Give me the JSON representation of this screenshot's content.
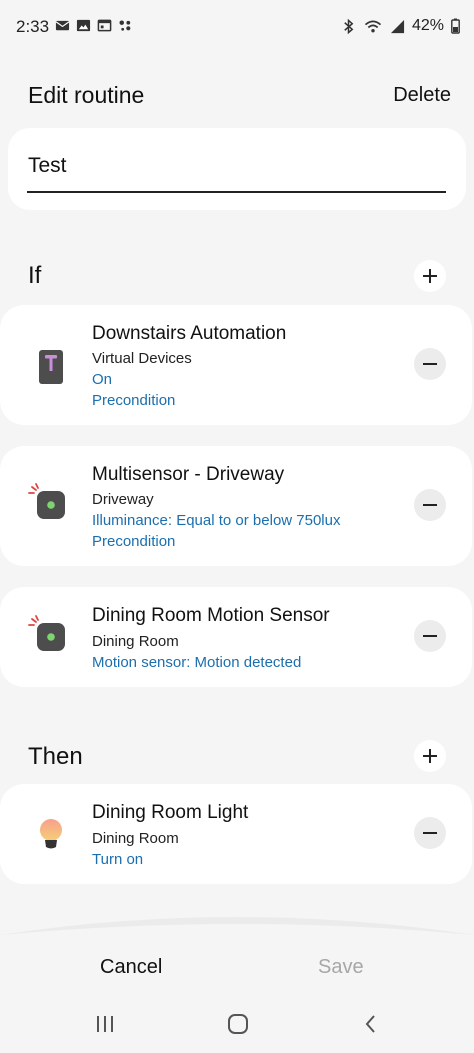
{
  "status_bar": {
    "time": "2:33",
    "battery": "42%"
  },
  "header": {
    "title": "Edit routine",
    "delete_label": "Delete"
  },
  "routine_name": {
    "value": "Test"
  },
  "if_section": {
    "title": "If",
    "conditions": [
      {
        "title": "Downstairs Automation",
        "subtitle": "Virtual Devices",
        "lines": [
          "On",
          "Precondition"
        ],
        "icon": "virtual-switch-icon"
      },
      {
        "title": "Multisensor - Driveway",
        "subtitle": "Driveway",
        "lines": [
          "Illuminance: Equal to or below 750lux",
          "Precondition"
        ],
        "icon": "sensor-icon"
      },
      {
        "title": "Dining Room Motion Sensor",
        "subtitle": "Dining Room",
        "lines": [
          "Motion sensor: Motion detected"
        ],
        "icon": "sensor-icon"
      }
    ]
  },
  "then_section": {
    "title": "Then",
    "actions": [
      {
        "title": "Dining Room Light",
        "subtitle": "Dining Room",
        "lines": [
          "Turn on"
        ],
        "icon": "bulb-icon"
      }
    ]
  },
  "footer": {
    "cancel_label": "Cancel",
    "save_label": "Save"
  },
  "colors": {
    "link": "#1b6fae",
    "background": "#f5f5f5",
    "card": "#ffffff",
    "disabled": "#a7a7a7"
  }
}
